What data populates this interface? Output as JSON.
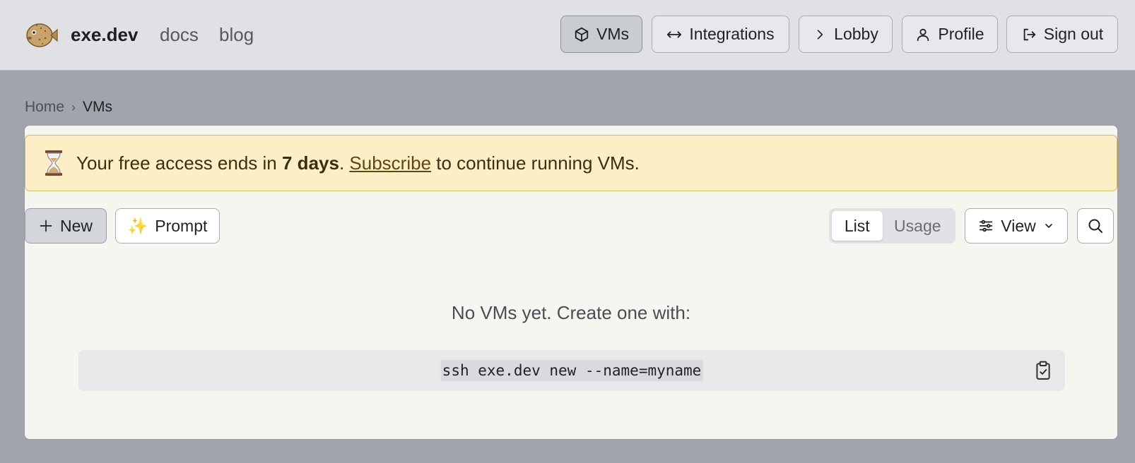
{
  "header": {
    "brand": "exe.dev",
    "nav_links": {
      "docs": "docs",
      "blog": "blog"
    },
    "buttons": {
      "vms": "VMs",
      "integrations": "Integrations",
      "lobby": "Lobby",
      "profile": "Profile",
      "sign_out": "Sign out"
    },
    "active_button": "vms",
    "icons": {
      "vms": "cube-icon",
      "integrations": "arrows-horizontal-icon",
      "lobby": "chevron-right-icon",
      "profile": "user-icon",
      "sign_out": "logout-icon",
      "logo": "pufferfish-icon"
    }
  },
  "breadcrumb": {
    "home": "Home",
    "separator": "›",
    "current": "VMs"
  },
  "banner": {
    "prefix": "Your free access ends in ",
    "days": "7 days",
    "dot": ". ",
    "link": "Subscribe",
    "suffix": " to continue running VMs.",
    "icon": "hourglass-icon"
  },
  "toolbar": {
    "new_label": "New",
    "prompt_label": "Prompt",
    "prompt_icon": "✨",
    "segments": {
      "list": "List",
      "usage": "Usage"
    },
    "selected_segment": "list",
    "view_label": "View"
  },
  "empty_state": {
    "message": "No VMs yet. Create one with:",
    "command": "ssh exe.dev new --name=myname"
  },
  "colors": {
    "banner_bg": "#fcefc6",
    "banner_border": "#d6b85f",
    "header_bg": "#dfe1e5",
    "page_bg": "#a1a4aa",
    "card_bg": "#f6f6f1"
  }
}
